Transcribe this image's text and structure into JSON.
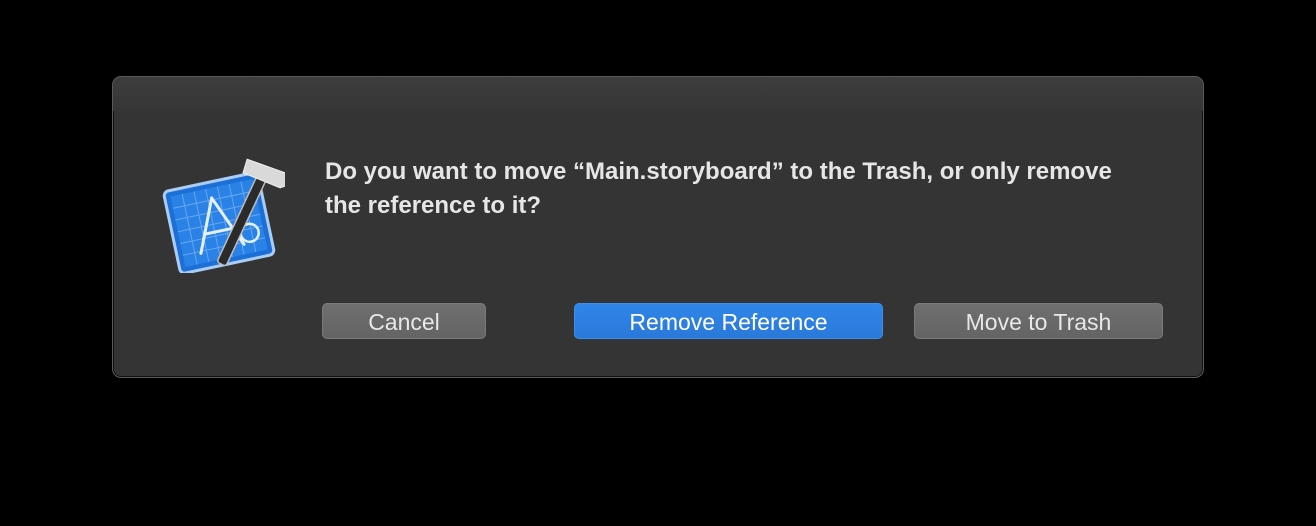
{
  "dialog": {
    "icon": "xcode-app-icon",
    "message": "Do you want to move “Main.storyboard” to the Trash, or only remove the reference to it?",
    "buttons": {
      "cancel_label": "Cancel",
      "remove_reference_label": "Remove Reference",
      "move_to_trash_label": "Move to Trash"
    }
  },
  "colors": {
    "background": "#000000",
    "dialog_background": "#343434",
    "primary_button": "#2a7fe0",
    "secondary_button": "#6a6a6a",
    "text": "#e6e6e6"
  }
}
